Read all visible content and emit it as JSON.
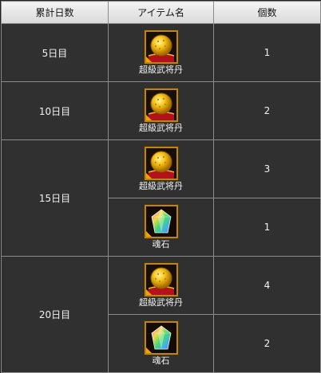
{
  "table": {
    "headers": [
      "累計日数",
      "アイテム名",
      "個数"
    ],
    "groups": [
      {
        "day": "5日目",
        "rows": [
          {
            "item": {
              "name": "超級武将丹",
              "icon": "gold-orb-icon"
            },
            "count": "1"
          }
        ]
      },
      {
        "day": "10日目",
        "rows": [
          {
            "item": {
              "name": "超級武将丹",
              "icon": "gold-orb-icon"
            },
            "count": "2"
          }
        ]
      },
      {
        "day": "15日目",
        "rows": [
          {
            "item": {
              "name": "超級武将丹",
              "icon": "gold-orb-icon"
            },
            "count": "3"
          },
          {
            "item": {
              "name": "魂石",
              "icon": "soul-stone-icon"
            },
            "count": "1"
          }
        ]
      },
      {
        "day": "20日目",
        "rows": [
          {
            "item": {
              "name": "超級武将丹",
              "icon": "gold-orb-icon"
            },
            "count": "4"
          },
          {
            "item": {
              "name": "魂石",
              "icon": "soul-stone-icon"
            },
            "count": "2"
          }
        ]
      }
    ]
  },
  "colors": {
    "cell_background": "#303030",
    "header_background": "#e6e6e6",
    "border": "#8c8c8c",
    "item_frame": "#b8861e",
    "text": "#f2f2f2"
  }
}
